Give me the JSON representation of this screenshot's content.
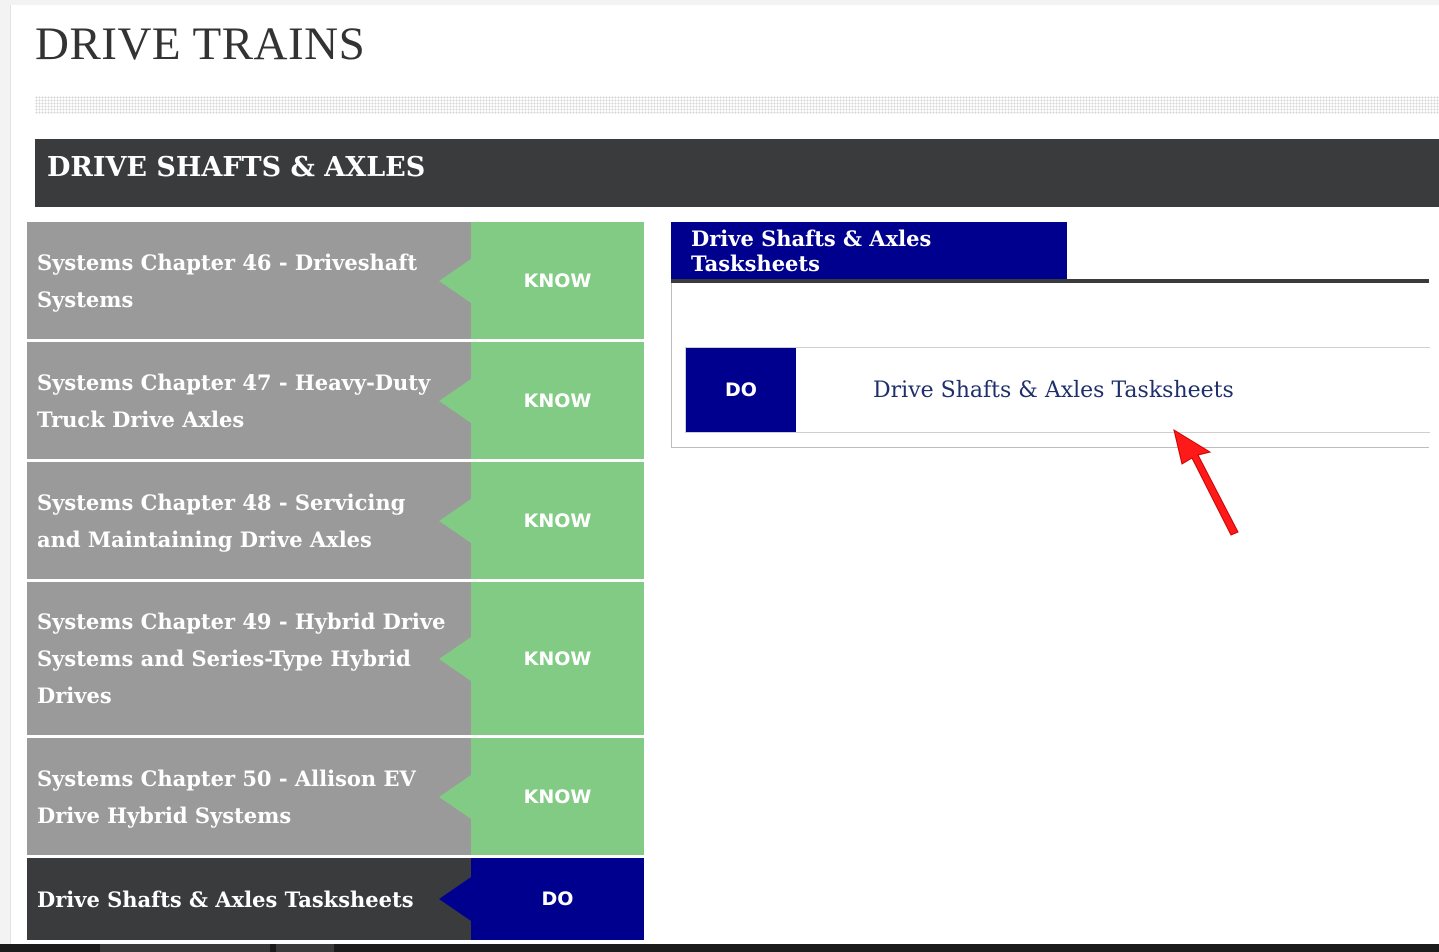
{
  "page": {
    "title": "DRIVE TRAINS"
  },
  "section": {
    "title": "DRIVE SHAFTS & AXLES"
  },
  "chapters": [
    {
      "label": "Systems Chapter 46 - Driveshaft Systems",
      "badge": "KNOW",
      "active": false
    },
    {
      "label": "Systems Chapter 47 - Heavy-Duty Truck Drive Axles",
      "badge": "KNOW",
      "active": false
    },
    {
      "label": "Systems Chapter 48 - Servicing and Maintaining Drive Axles",
      "badge": "KNOW",
      "active": false
    },
    {
      "label": "Systems Chapter 49 - Hybrid Drive Systems and Series-Type Hybrid Drives",
      "badge": "KNOW",
      "active": false
    },
    {
      "label": "Systems Chapter 50 - Allison EV Drive Hybrid Systems",
      "badge": "KNOW",
      "active": false
    },
    {
      "label": "Drive Shafts & Axles Tasksheets",
      "badge": "DO",
      "active": true
    }
  ],
  "task_panel": {
    "tab_label": "Drive Shafts & Axles Tasksheets",
    "item": {
      "badge": "DO",
      "link_text": "Drive Shafts & Axles Tasksheets"
    }
  },
  "annotation": {
    "icon": "red-pointer-arrow-icon",
    "color": "#ff1a1a"
  },
  "colors": {
    "know_green": "#82cb84",
    "do_navy": "#00008f",
    "chapter_gray": "#9a9a9a",
    "dark_bar": "#3a3b3d"
  }
}
